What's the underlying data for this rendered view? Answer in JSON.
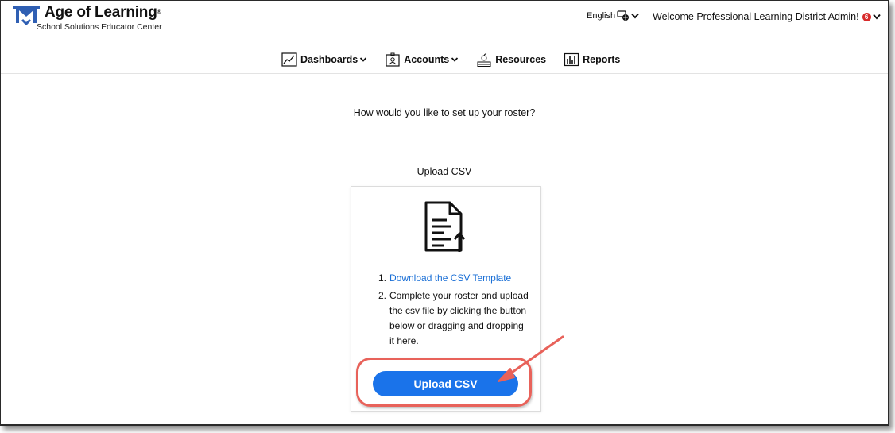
{
  "header": {
    "logo_title": "Age of Learning",
    "logo_trademark": "®",
    "logo_subtitle": "School Solutions Educator Center",
    "language": "English",
    "welcome_text": "Welcome Professional Learning District Admin!",
    "notification_count": "6"
  },
  "nav": {
    "items": [
      {
        "label": "Dashboards",
        "icon": "line-chart-icon",
        "has_dropdown": true
      },
      {
        "label": "Accounts",
        "icon": "id-card-icon",
        "has_dropdown": true
      },
      {
        "label": "Resources",
        "icon": "books-icon",
        "has_dropdown": false
      },
      {
        "label": "Reports",
        "icon": "bar-chart-icon",
        "has_dropdown": false
      }
    ]
  },
  "main": {
    "question": "How would you like to set up your roster?",
    "option_heading": "Upload CSV",
    "steps": [
      {
        "number": "1.",
        "text": "Download the CSV Template"
      },
      {
        "number": "2.",
        "text": "Complete your roster and upload the csv file by clicking the button below or dragging and dropping it here."
      }
    ],
    "upload_button_label": "Upload CSV"
  },
  "colors": {
    "accent": "#1a73ea",
    "link": "#1a6fd6",
    "logo": "#2f5fb3",
    "badge": "#d82a2a",
    "annotation": "#e8625a"
  }
}
